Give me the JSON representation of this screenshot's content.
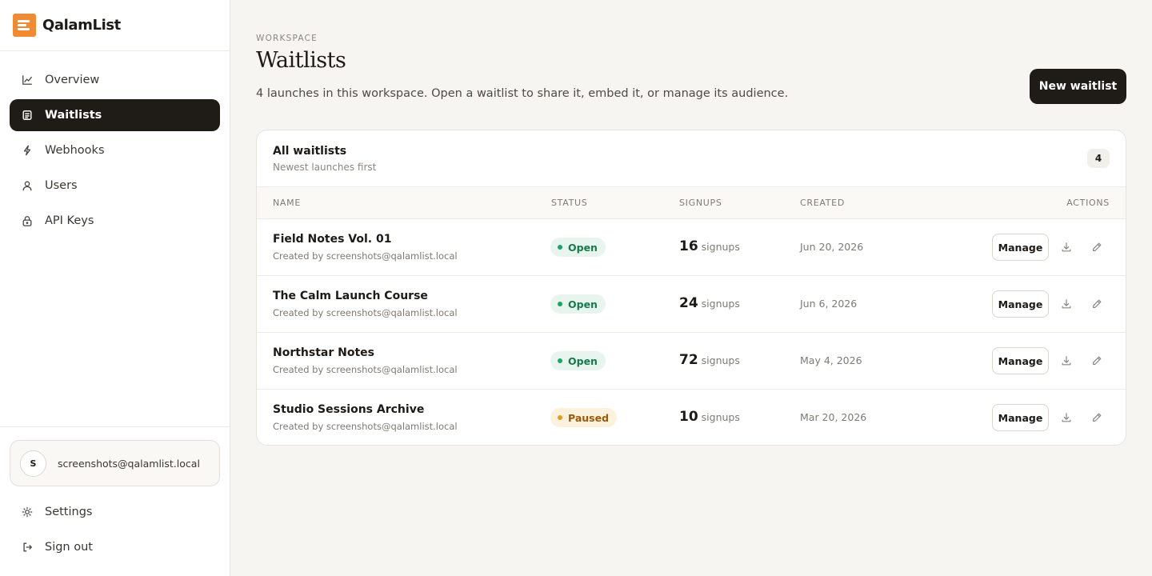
{
  "brand": {
    "name": "QalamList",
    "accent": "#f08a33"
  },
  "nav": [
    {
      "label": "Overview",
      "icon": "chart-line-icon",
      "active": false
    },
    {
      "label": "Waitlists",
      "icon": "list-doc-icon",
      "active": true
    },
    {
      "label": "Webhooks",
      "icon": "bolt-icon",
      "active": false
    },
    {
      "label": "Users",
      "icon": "user-icon",
      "active": false
    },
    {
      "label": "API Keys",
      "icon": "lock-icon",
      "active": false
    }
  ],
  "user": {
    "initial": "S",
    "email": "screenshots@qalamlist.local"
  },
  "bottom_nav": {
    "settings": "Settings",
    "signout": "Sign out"
  },
  "page": {
    "eyebrow": "WORKSPACE",
    "title": "Waitlists",
    "subtitle": "4 launches in this workspace. Open a waitlist to share it, embed it, or manage its audience.",
    "new_button": "New waitlist"
  },
  "table": {
    "title": "All waitlists",
    "subtitle": "Newest launches first",
    "count": "4",
    "columns": [
      "NAME",
      "STATUS",
      "SIGNUPS",
      "CREATED",
      "ACTIONS"
    ],
    "signups_unit": "signups",
    "manage_label": "Manage",
    "rows": [
      {
        "name": "Field Notes Vol. 01",
        "by": "Created by screenshots@qalamlist.local",
        "status": "Open",
        "signups": "16",
        "created": "Jun 20, 2026"
      },
      {
        "name": "The Calm Launch Course",
        "by": "Created by screenshots@qalamlist.local",
        "status": "Open",
        "signups": "24",
        "created": "Jun 6, 2026"
      },
      {
        "name": "Northstar Notes",
        "by": "Created by screenshots@qalamlist.local",
        "status": "Open",
        "signups": "72",
        "created": "May 4, 2026"
      },
      {
        "name": "Studio Sessions Archive",
        "by": "Created by screenshots@qalamlist.local",
        "status": "Paused",
        "signups": "10",
        "created": "Mar 20, 2026"
      }
    ]
  }
}
